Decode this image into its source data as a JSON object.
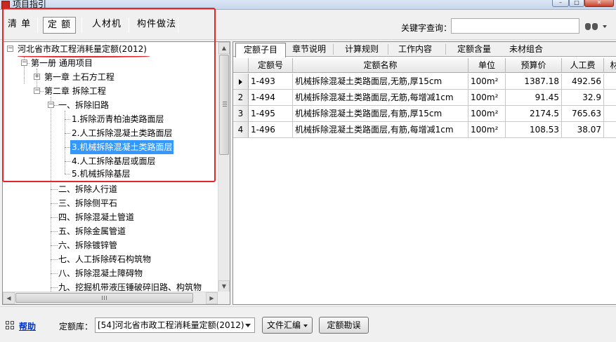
{
  "window": {
    "title": "项目指引",
    "min_glyph": "–",
    "max_glyph": "□",
    "close_glyph": "✕"
  },
  "toolbar": {
    "tabs": [
      "清 单",
      "定 额",
      "人材机",
      "构件做法"
    ],
    "active_tab": "定 额",
    "keyword_label": "关键字查询：",
    "keyword_value": "",
    "search_icon": "binoculars-icon"
  },
  "tree": {
    "items": [
      {
        "label": "河北省市政工程消耗量定额(2012)",
        "level": 0,
        "expander": "−"
      },
      {
        "label": "第一册 通用项目",
        "level": 1,
        "expander": "−"
      },
      {
        "label": "第一章 土石方工程",
        "level": 2,
        "expander": "+"
      },
      {
        "label": "第二章 拆除工程",
        "level": 2,
        "expander": "−"
      },
      {
        "label": "一、拆除旧路",
        "level": 3,
        "expander": "−"
      },
      {
        "label": "1.拆除沥青柏油类路面层",
        "level": 4
      },
      {
        "label": "2.人工拆除混凝土类路面层",
        "level": 4
      },
      {
        "label": "3.机械拆除混凝土类路面层",
        "level": 4,
        "selected": true
      },
      {
        "label": "4.人工拆除基层或面层",
        "level": 4
      },
      {
        "label": "5.机械拆除基层",
        "level": 4
      },
      {
        "label": "二、拆除人行道",
        "level": 3
      },
      {
        "label": "三、拆除侧平石",
        "level": 3
      },
      {
        "label": "四、拆除混凝土管道",
        "level": 3
      },
      {
        "label": "五、拆除金属管道",
        "level": 3
      },
      {
        "label": "六、拆除镀锌管",
        "level": 3
      },
      {
        "label": "七、人工拆除砖石构筑物",
        "level": 3
      },
      {
        "label": "八、拆除混凝土障碍物",
        "level": 3
      },
      {
        "label": "九、挖掘机带液压锤破碎旧路、构筑物",
        "level": 3
      }
    ],
    "scroll_up": "▲",
    "scroll_down": "▼",
    "scroll_left": "◀",
    "scroll_right": "▶"
  },
  "detail_tabs": [
    "定额子目",
    "章节说明",
    "计算规则",
    "工作内容",
    "定额含量",
    "未材组合"
  ],
  "active_detail_tab": "定额子目",
  "grid": {
    "columns": [
      "",
      "定额号",
      "定额名称",
      "单位",
      "预算价",
      "人工费",
      "材"
    ],
    "rows": [
      {
        "index": "",
        "marker": true,
        "code": "1-493",
        "name": "机械拆除混凝土类路面层,无筋,厚15cm",
        "unit": "100m²",
        "price": "1387.18",
        "labor": "492.56"
      },
      {
        "index": "2",
        "code": "1-494",
        "name": "机械拆除混凝土类路面层,无筋,每增减1cm",
        "unit": "100m²",
        "price": "91.45",
        "labor": "32.9"
      },
      {
        "index": "3",
        "code": "1-495",
        "name": "机械拆除混凝土类路面层,有筋,厚15cm",
        "unit": "100m²",
        "price": "2174.5",
        "labor": "765.63"
      },
      {
        "index": "4",
        "code": "1-496",
        "name": "机械拆除混凝土类路面层,有筋,每增减1cm",
        "unit": "100m²",
        "price": "108.53",
        "labor": "38.07"
      }
    ]
  },
  "bottom": {
    "help_label": "帮助",
    "library_label": "定额库：",
    "library_value": "[54]河北省市政工程消耗量定额(2012)",
    "summary_button": "文件汇编",
    "errata_button": "定额勘误"
  },
  "colors": {
    "selection": "#3399ff",
    "highlight_box": "#e3262a",
    "help_link": "#0033cc"
  }
}
